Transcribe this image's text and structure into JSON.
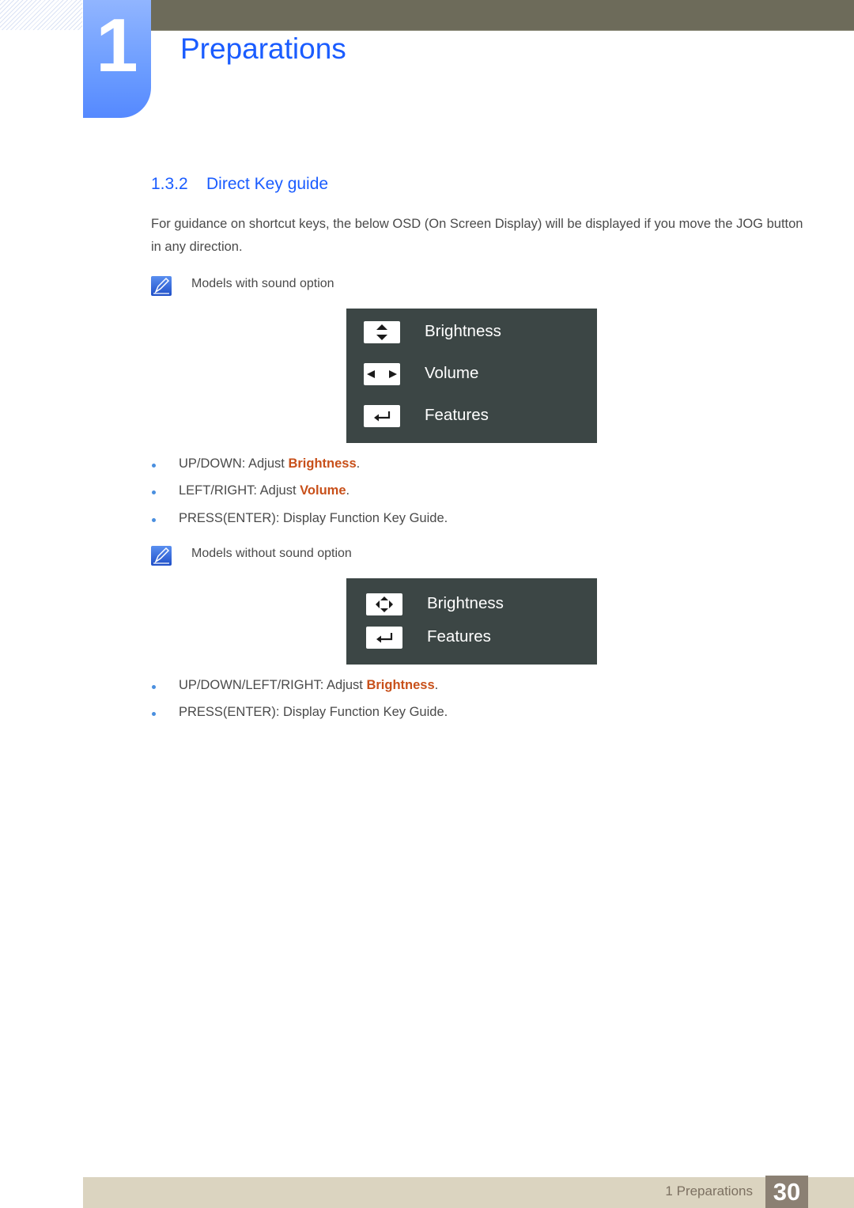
{
  "header": {
    "chapter_number": "1",
    "chapter_title": "Preparations"
  },
  "section": {
    "number": "1.3.2",
    "title": "Direct Key guide"
  },
  "intro_text": "For guidance on shortcut keys, the below OSD (On Screen Display) will be displayed if you move the JOG button in any direction.",
  "with_sound": {
    "note": "Models with sound option",
    "osd_items": [
      {
        "icon": "up-down-arrows-icon",
        "label": "Brightness"
      },
      {
        "icon": "left-right-arrows-icon",
        "label": "Volume"
      },
      {
        "icon": "enter-icon",
        "label": "Features"
      }
    ],
    "bullets": [
      {
        "prefix": "UP/DOWN: Adjust ",
        "highlight": "Brightness",
        "suffix": "."
      },
      {
        "prefix": "LEFT/RIGHT: Adjust ",
        "highlight": "Volume",
        "suffix": "."
      },
      {
        "prefix": "PRESS(ENTER): Display Function Key Guide.",
        "highlight": "",
        "suffix": ""
      }
    ]
  },
  "without_sound": {
    "note": "Models without sound option",
    "osd_items": [
      {
        "icon": "four-way-arrows-icon",
        "label": "Brightness"
      },
      {
        "icon": "enter-icon",
        "label": "Features"
      }
    ],
    "bullets": [
      {
        "prefix": "UP/DOWN/LEFT/RIGHT: Adjust ",
        "highlight": "Brightness",
        "suffix": "."
      },
      {
        "prefix": "PRESS(ENTER): Display Function Key Guide.",
        "highlight": "",
        "suffix": ""
      }
    ]
  },
  "footer": {
    "chapter_label": "1 Preparations",
    "page_number": "30"
  },
  "colors": {
    "accent_blue": "#1a5cff",
    "highlight_orange": "#c8501a",
    "osd_background": "#3c4645",
    "header_bar": "#6d6b5a",
    "footer_bar": "#dbd4c0",
    "page_badge": "#8b8073"
  }
}
